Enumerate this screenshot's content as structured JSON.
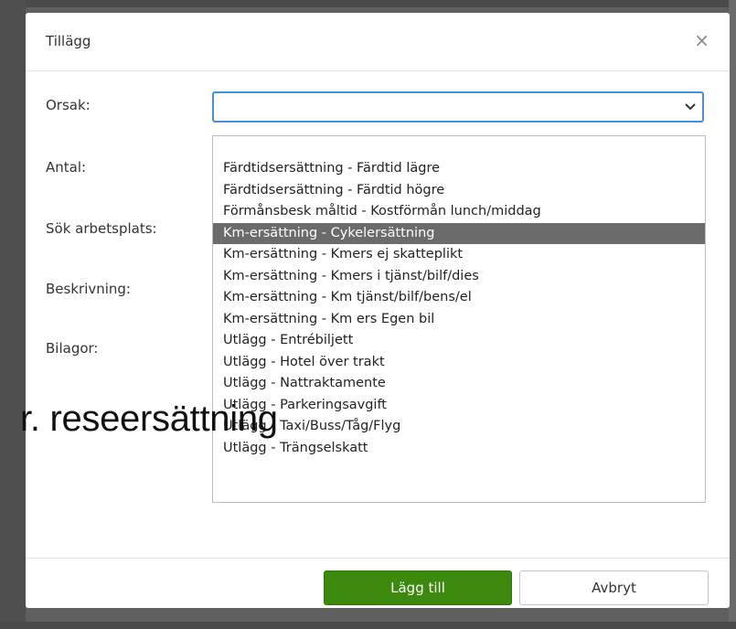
{
  "dialog": {
    "title": "Tillägg",
    "close_icon": "close-icon"
  },
  "form": {
    "labels": {
      "orsak": "Orsak:",
      "antal": "Antal:",
      "sok_arbetsplats": "Sök arbetsplats:",
      "beskrivning": "Beskrivning:",
      "bilagor": "Bilagor:"
    },
    "orsak_select": {
      "value": "",
      "icon": "chevron-down-icon",
      "border_color": "#4a8fd1"
    }
  },
  "dropdown": {
    "options": [
      "Färdtidsersättning - Färdtid lägre",
      "Färdtidsersättning - Färdtid högre",
      "Förmånsbesk måltid - Kostförmån lunch/middag",
      "Km-ersättning - Cykelersättning",
      "Km-ersättning - Kmers ej skatteplikt",
      "Km-ersättning - Kmers i tjänst/bilf/dies",
      "Km-ersättning - Km tjänst/bilf/bens/el",
      "Km-ersättning - Km ers Egen bil",
      "Utlägg - Entrébiljett",
      "Utlägg - Hotel över trakt",
      "Utlägg - Nattraktamente",
      "Utlägg - Parkeringsavgift",
      "Utlägg - Taxi/Buss/Tåg/Flyg",
      "Utlägg - Trängselskatt"
    ],
    "selected_index": 3,
    "highlight_color": "#6b6b6b"
  },
  "overlay_caption": "r. reseersättning",
  "footer": {
    "add_label": "Lägg till",
    "cancel_label": "Avbryt",
    "primary_color": "#3b8a0e"
  }
}
